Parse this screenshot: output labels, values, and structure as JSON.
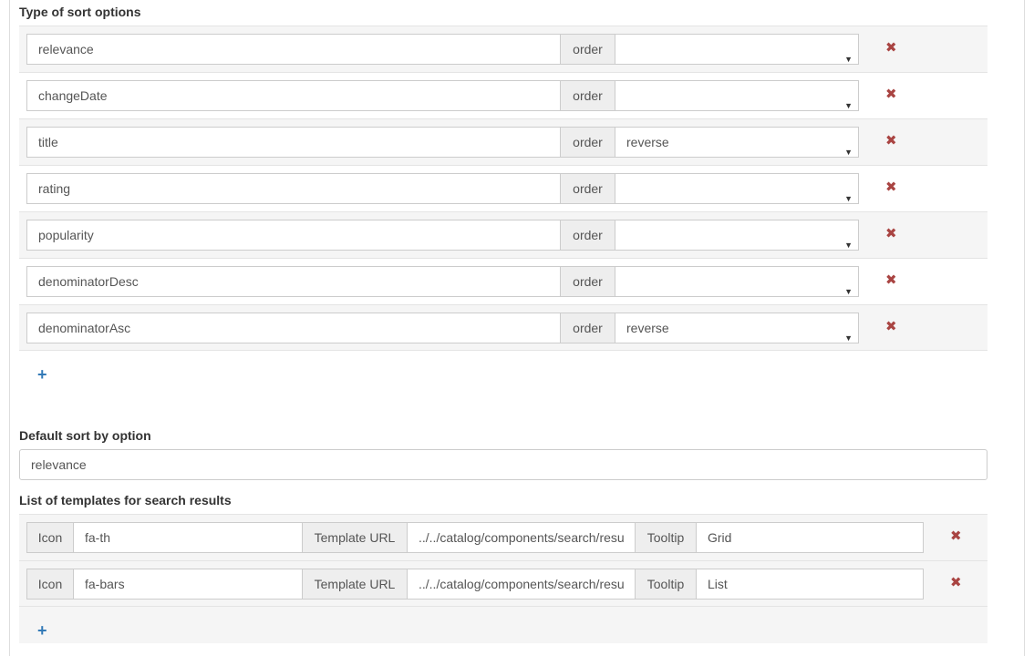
{
  "sort_options": {
    "heading": "Type of sort options",
    "order_label": "order",
    "remove_glyph": "✖",
    "add_glyph": "+",
    "items": [
      {
        "name": "relevance",
        "order": ""
      },
      {
        "name": "changeDate",
        "order": ""
      },
      {
        "name": "title",
        "order": "reverse"
      },
      {
        "name": "rating",
        "order": ""
      },
      {
        "name": "popularity",
        "order": ""
      },
      {
        "name": "denominatorDesc",
        "order": ""
      },
      {
        "name": "denominatorAsc",
        "order": "reverse"
      }
    ]
  },
  "default_sort": {
    "heading": "Default sort by option",
    "value": "relevance"
  },
  "templates": {
    "heading": "List of templates for search results",
    "icon_label": "Icon",
    "url_label": "Template URL",
    "tooltip_label": "Tooltip",
    "items": [
      {
        "icon": "fa-th",
        "url": "../../catalog/components/search/resu",
        "tooltip": "Grid"
      },
      {
        "icon": "fa-bars",
        "url": "../../catalog/components/search/resu",
        "tooltip": "List"
      }
    ]
  },
  "colors": {
    "remove": "#a94442",
    "add": "#337ab7",
    "stripe": "#f5f5f5"
  }
}
